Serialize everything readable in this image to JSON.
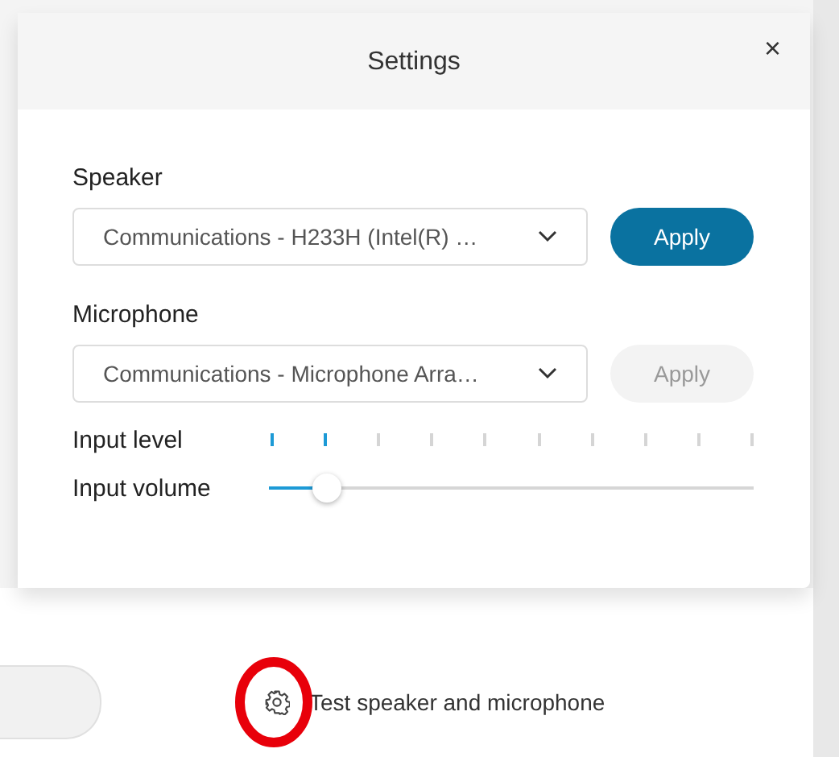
{
  "dialog": {
    "title": "Settings",
    "close": "×"
  },
  "speaker": {
    "label": "Speaker",
    "value": "Communications - H233H (Intel(R) …",
    "apply": {
      "label": "Apply",
      "disabled": false
    }
  },
  "microphone": {
    "label": "Microphone",
    "value": "Communications - Microphone Arra…",
    "apply": {
      "label": "Apply",
      "disabled": true
    }
  },
  "input_level": {
    "label": "Input level",
    "level": 0.2
  },
  "input_volume": {
    "label": "Input volume",
    "level": 0.12
  },
  "footer": {
    "test_link": {
      "label": "Test speaker and microphone",
      "highlighted": true
    }
  }
}
